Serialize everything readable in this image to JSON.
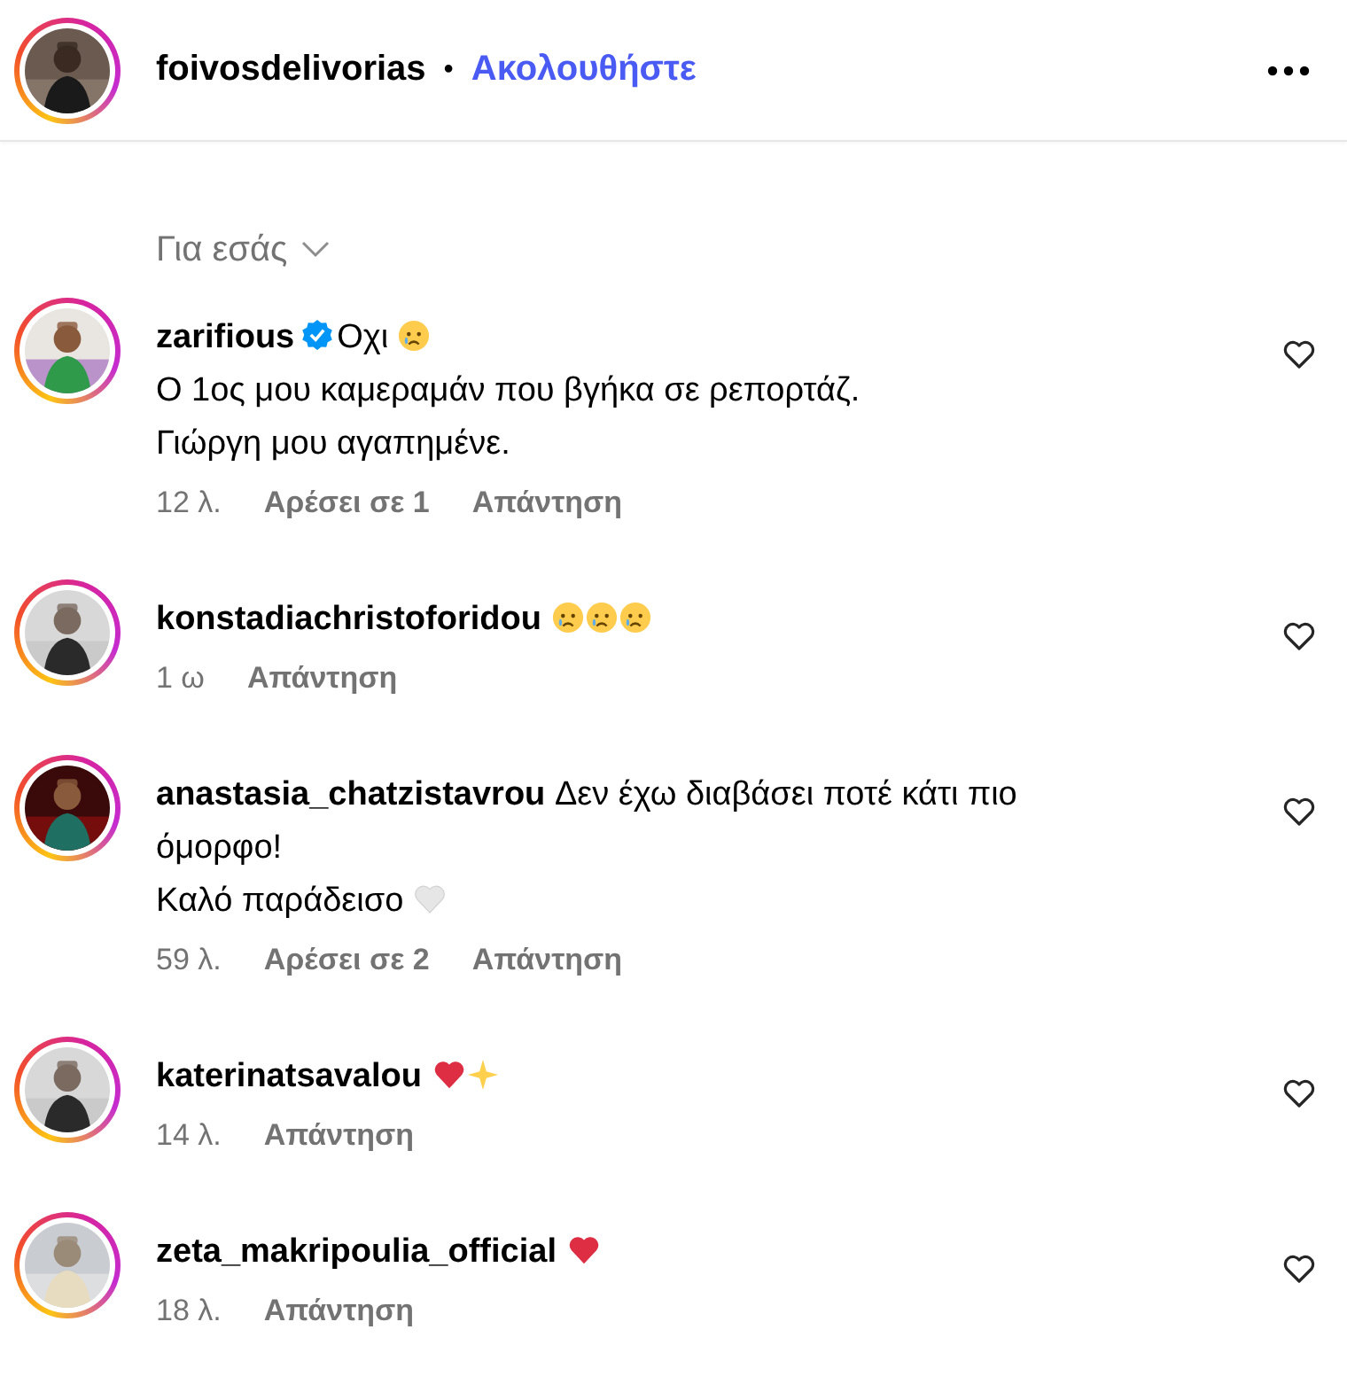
{
  "header": {
    "username": "foivosdelivorias",
    "separator": "•",
    "follow": "Ακολουθήστε"
  },
  "filter": {
    "label": "Για εσάς"
  },
  "comments": [
    {
      "username": "zarifious",
      "verified": true,
      "body": [
        {
          "kind": "text",
          "text": "Οχι "
        },
        {
          "kind": "crying"
        },
        {
          "kind": "text",
          "text": "\nΟ 1ος μου καμεραμάν που βγήκα σε ρεπορτάζ.\nΓιώργη μου αγαπημένε."
        }
      ],
      "time": "12 λ.",
      "likes": "Αρέσει σε 1",
      "reply": "Απάντηση"
    },
    {
      "username": "konstadiachristoforidou",
      "verified": false,
      "body": [
        {
          "kind": "crying"
        },
        {
          "kind": "crying"
        },
        {
          "kind": "crying"
        }
      ],
      "time": "1 ω",
      "reply": "Απάντηση"
    },
    {
      "username": "anastasia_chatzistavrou",
      "verified": false,
      "body": [
        {
          "kind": "text",
          "text": " Δεν έχω διαβάσει ποτέ κάτι πιο όμορφο!\nΚαλό παράδεισο "
        },
        {
          "kind": "white-heart"
        }
      ],
      "time": "59 λ.",
      "likes": "Αρέσει σε 2",
      "reply": "Απάντηση"
    },
    {
      "username": "katerinatsavalou",
      "verified": false,
      "body": [
        {
          "kind": "heart"
        },
        {
          "kind": "sparkle"
        }
      ],
      "time": "14 λ.",
      "reply": "Απάντηση"
    },
    {
      "username": "zeta_makripoulia_official",
      "verified": false,
      "body": [
        {
          "kind": "heart"
        }
      ],
      "time": "18 λ.",
      "reply": "Απάντηση"
    }
  ]
}
